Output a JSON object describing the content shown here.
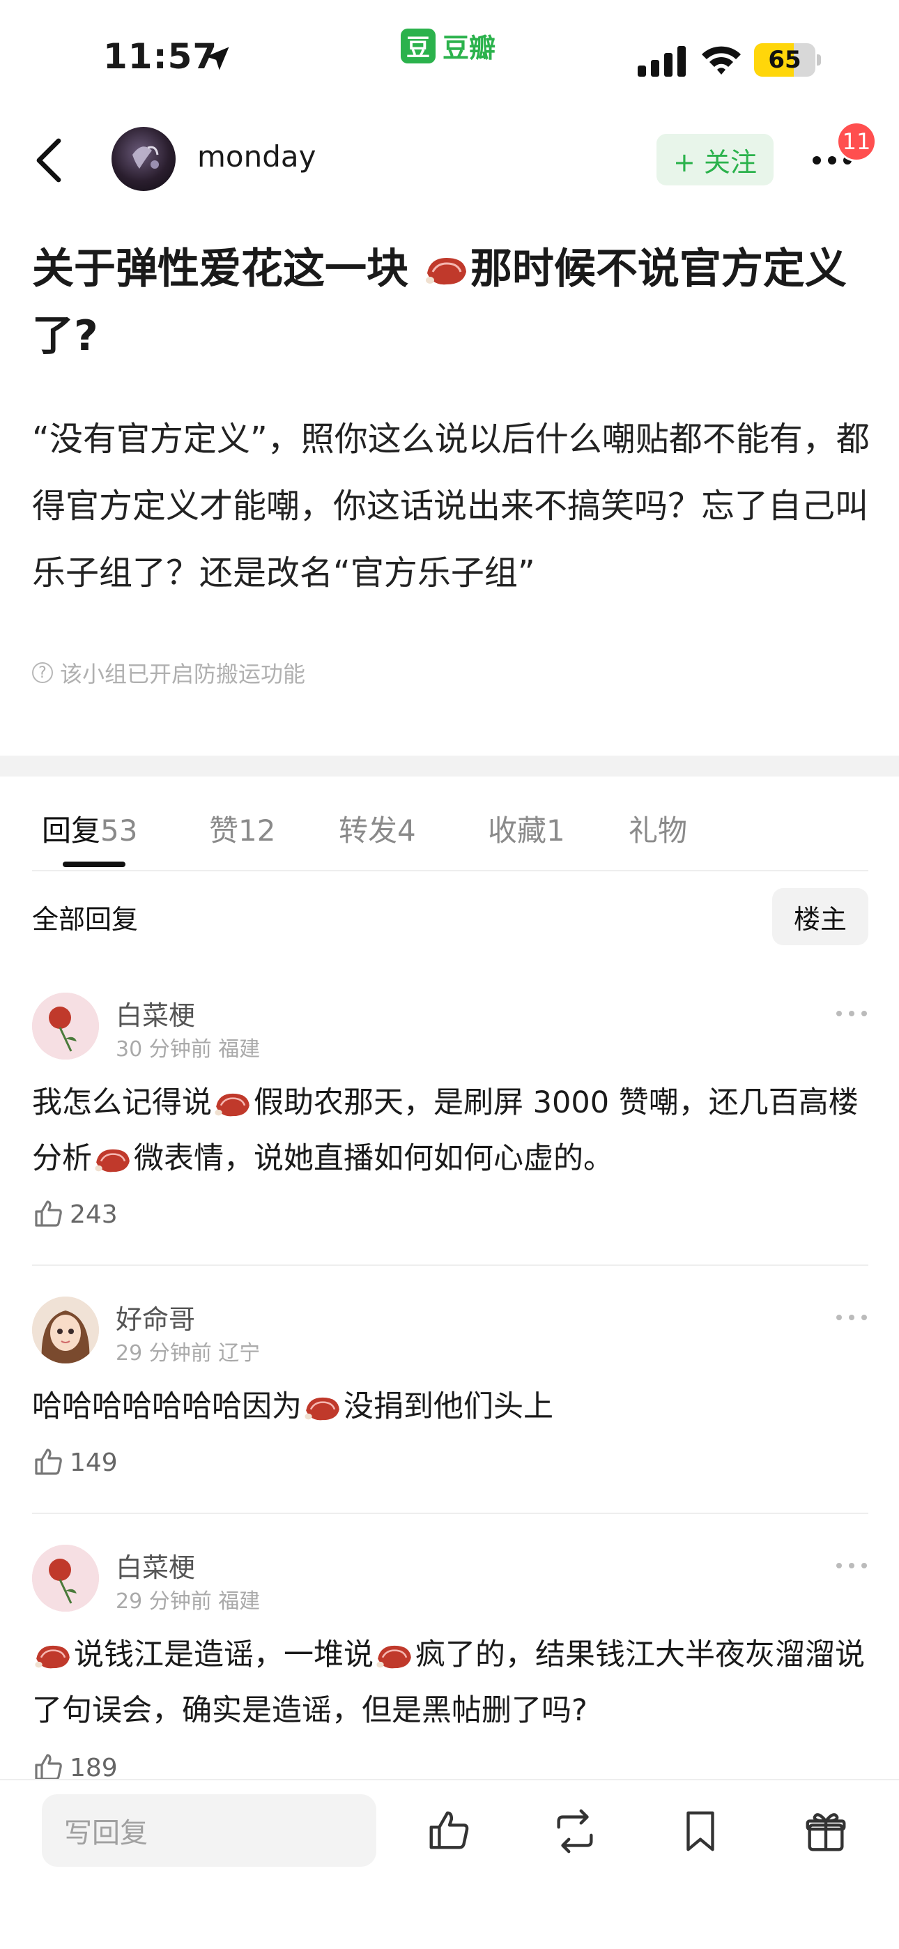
{
  "status_bar": {
    "time": "11:57",
    "app_name": "豆瓣",
    "app_logo_char": "豆",
    "battery_percent": 65,
    "battery_label": "65"
  },
  "header": {
    "username": "monday",
    "follow_label": "+ 关注",
    "notification_count": "11"
  },
  "post": {
    "title_part1": "关于弹性爱花这一块 ",
    "title_part2": "那时候不说官方定义了?",
    "body": "“没有官方定义”，照你这么说以后什么嘲贴都不能有，都得官方定义才能嘲，你这话说出来不搞笑吗？忘了自己叫乐子组了？还是改名“官方乐子组”",
    "anti_copy_notice": "该小组已开启防搬运功能"
  },
  "tabs": [
    {
      "label": "回复",
      "count": "53"
    },
    {
      "label": "赞",
      "count": "12"
    },
    {
      "label": "转发",
      "count": "4"
    },
    {
      "label": "收藏",
      "count": "1"
    },
    {
      "label": "礼物",
      "count": ""
    }
  ],
  "filter": {
    "all_replies": "全部回复",
    "op_only": "楼主"
  },
  "comments": [
    {
      "name": "白菜梗",
      "meta": "30 分钟前  福建",
      "text_a": "我怎么记得说",
      "text_b": "假助农那天，是刷屏 3000 赞嘲，还几百高楼分析",
      "text_c": "微表情，说她直播如何如何心虚的。",
      "likes": "243"
    },
    {
      "name": "好命哥",
      "meta": "29 分钟前  辽宁",
      "text_a": "哈哈哈哈哈哈哈因为",
      "text_b": "没捐到他们头上",
      "likes": "149"
    },
    {
      "name": "白菜梗",
      "meta": "29 分钟前  福建",
      "text_b": "说钱江是造谣，一堆说",
      "text_c": "疯了的，结果钱江大半夜灰溜溜说了句误会，确实是造谣，但是黑帖删了吗?",
      "likes": "189"
    }
  ],
  "bottom_bar": {
    "reply_placeholder": "写回复"
  },
  "colors": {
    "brand_green": "#2bb24c",
    "badge_red": "#ff4f4f",
    "battery_yellow": "#ffd60a"
  }
}
